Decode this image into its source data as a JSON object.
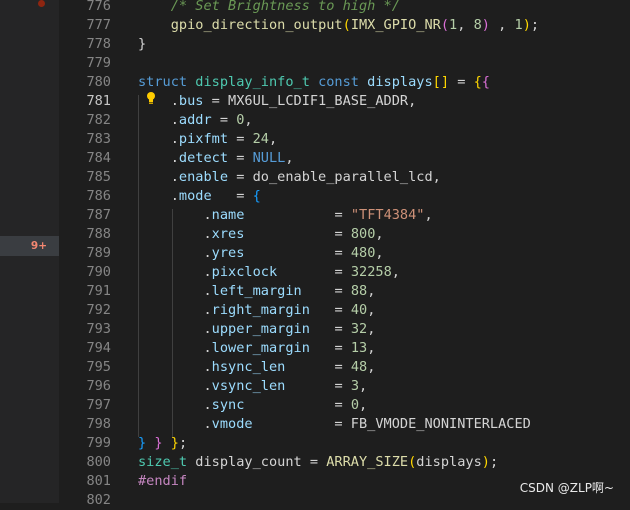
{
  "gutter": {
    "problem_badge": "9+"
  },
  "lines": [
    {
      "n": "776",
      "tokens": [
        [
          "cmt",
          "    /* Set Brightness to high */"
        ]
      ]
    },
    {
      "n": "777",
      "tokens": [
        [
          "txt",
          "    "
        ],
        [
          "fn",
          "gpio_direction_output"
        ],
        [
          "br1",
          "("
        ],
        [
          "fn",
          "IMX_GPIO_NR"
        ],
        [
          "br2",
          "("
        ],
        [
          "num",
          "1"
        ],
        [
          "txt",
          ", "
        ],
        [
          "num",
          "8"
        ],
        [
          "br2",
          ")"
        ],
        [
          "txt",
          " , "
        ],
        [
          "num",
          "1"
        ],
        [
          "br1",
          ")"
        ],
        [
          "txt",
          ";"
        ]
      ]
    },
    {
      "n": "778",
      "tokens": [
        [
          "txt",
          "}"
        ]
      ]
    },
    {
      "n": "779",
      "tokens": []
    },
    {
      "n": "780",
      "tokens": [
        [
          "kw",
          "struct"
        ],
        [
          "txt",
          " "
        ],
        [
          "ty",
          "display_info_t"
        ],
        [
          "txt",
          " "
        ],
        [
          "kw",
          "const"
        ],
        [
          "txt",
          " "
        ],
        [
          "prop",
          "displays"
        ],
        [
          "br1",
          "[]"
        ],
        [
          "txt",
          " = "
        ],
        [
          "br1",
          "{"
        ],
        [
          "br2",
          "{"
        ]
      ]
    },
    {
      "n": "781",
      "active": true,
      "tokens": [
        [
          "txt",
          "    ."
        ],
        [
          "prop",
          "bus"
        ],
        [
          "txt",
          " = MX6UL_LCDIF1_BASE_ADDR,"
        ]
      ]
    },
    {
      "n": "782",
      "tokens": [
        [
          "txt",
          "    ."
        ],
        [
          "prop",
          "addr"
        ],
        [
          "txt",
          " = "
        ],
        [
          "num",
          "0"
        ],
        [
          "txt",
          ","
        ]
      ]
    },
    {
      "n": "783",
      "tokens": [
        [
          "txt",
          "    ."
        ],
        [
          "prop",
          "pixfmt"
        ],
        [
          "txt",
          " = "
        ],
        [
          "num",
          "24"
        ],
        [
          "txt",
          ","
        ]
      ]
    },
    {
      "n": "784",
      "tokens": [
        [
          "txt",
          "    ."
        ],
        [
          "prop",
          "detect"
        ],
        [
          "txt",
          " = "
        ],
        [
          "kw",
          "NULL"
        ],
        [
          "txt",
          ","
        ]
      ]
    },
    {
      "n": "785",
      "tokens": [
        [
          "txt",
          "    ."
        ],
        [
          "prop",
          "enable"
        ],
        [
          "txt",
          " = do_enable_parallel_lcd,"
        ]
      ]
    },
    {
      "n": "786",
      "tokens": [
        [
          "txt",
          "    ."
        ],
        [
          "prop",
          "mode"
        ],
        [
          "txt",
          "   = "
        ],
        [
          "br3",
          "{"
        ]
      ]
    },
    {
      "n": "787",
      "tokens": [
        [
          "txt",
          "        ."
        ],
        [
          "prop",
          "name"
        ],
        [
          "txt",
          "           = "
        ],
        [
          "str",
          "\"TFT4384\""
        ],
        [
          "txt",
          ","
        ]
      ]
    },
    {
      "n": "788",
      "tokens": [
        [
          "txt",
          "        ."
        ],
        [
          "prop",
          "xres"
        ],
        [
          "txt",
          "           = "
        ],
        [
          "num",
          "800"
        ],
        [
          "txt",
          ","
        ]
      ]
    },
    {
      "n": "789",
      "tokens": [
        [
          "txt",
          "        ."
        ],
        [
          "prop",
          "yres"
        ],
        [
          "txt",
          "           = "
        ],
        [
          "num",
          "480"
        ],
        [
          "txt",
          ","
        ]
      ]
    },
    {
      "n": "790",
      "tokens": [
        [
          "txt",
          "        ."
        ],
        [
          "prop",
          "pixclock"
        ],
        [
          "txt",
          "       = "
        ],
        [
          "num",
          "32258"
        ],
        [
          "txt",
          ","
        ]
      ]
    },
    {
      "n": "791",
      "tokens": [
        [
          "txt",
          "        ."
        ],
        [
          "prop",
          "left_margin"
        ],
        [
          "txt",
          "    = "
        ],
        [
          "num",
          "88"
        ],
        [
          "txt",
          ","
        ]
      ]
    },
    {
      "n": "792",
      "tokens": [
        [
          "txt",
          "        ."
        ],
        [
          "prop",
          "right_margin"
        ],
        [
          "txt",
          "   = "
        ],
        [
          "num",
          "40"
        ],
        [
          "txt",
          ","
        ]
      ]
    },
    {
      "n": "793",
      "tokens": [
        [
          "txt",
          "        ."
        ],
        [
          "prop",
          "upper_margin"
        ],
        [
          "txt",
          "   = "
        ],
        [
          "num",
          "32"
        ],
        [
          "txt",
          ","
        ]
      ]
    },
    {
      "n": "794",
      "tokens": [
        [
          "txt",
          "        ."
        ],
        [
          "prop",
          "lower_margin"
        ],
        [
          "txt",
          "   = "
        ],
        [
          "num",
          "13"
        ],
        [
          "txt",
          ","
        ]
      ]
    },
    {
      "n": "795",
      "tokens": [
        [
          "txt",
          "        ."
        ],
        [
          "prop",
          "hsync_len"
        ],
        [
          "txt",
          "      = "
        ],
        [
          "num",
          "48"
        ],
        [
          "txt",
          ","
        ]
      ]
    },
    {
      "n": "796",
      "tokens": [
        [
          "txt",
          "        ."
        ],
        [
          "prop",
          "vsync_len"
        ],
        [
          "txt",
          "      = "
        ],
        [
          "num",
          "3"
        ],
        [
          "txt",
          ","
        ]
      ]
    },
    {
      "n": "797",
      "tokens": [
        [
          "txt",
          "        ."
        ],
        [
          "prop",
          "sync"
        ],
        [
          "txt",
          "           = "
        ],
        [
          "num",
          "0"
        ],
        [
          "txt",
          ","
        ]
      ]
    },
    {
      "n": "798",
      "tokens": [
        [
          "txt",
          "        ."
        ],
        [
          "prop",
          "vmode"
        ],
        [
          "txt",
          "          = FB_VMODE_NONINTERLACED"
        ]
      ]
    },
    {
      "n": "799",
      "tokens": [
        [
          "br3",
          "}"
        ],
        [
          "txt",
          " "
        ],
        [
          "br2",
          "}"
        ],
        [
          "txt",
          " "
        ],
        [
          "br1",
          "}"
        ],
        [
          "txt",
          ";"
        ]
      ]
    },
    {
      "n": "800",
      "tokens": [
        [
          "ty",
          "size_t"
        ],
        [
          "txt",
          " display_count = "
        ],
        [
          "fn",
          "ARRAY_SIZE"
        ],
        [
          "br1",
          "("
        ],
        [
          "txt",
          "displays"
        ],
        [
          "br1",
          ")"
        ],
        [
          "txt",
          ";"
        ]
      ]
    },
    {
      "n": "801",
      "tokens": [
        [
          "pre",
          "#endif"
        ]
      ]
    },
    {
      "n": "802",
      "tokens": []
    }
  ],
  "watermark": "CSDN @ZLP啊~",
  "colors": {
    "background": "#1e1e1e",
    "keyword": "#569cd6",
    "type": "#4ec9b0",
    "function": "#dcdcaa",
    "number": "#b5cea8",
    "string": "#ce9178",
    "property": "#9cdcfe",
    "comment": "#6a9955",
    "problem": "#f48771"
  },
  "icons": {
    "code_action": "lightbulb-icon",
    "breakpoint": "breakpoint-dot-icon"
  }
}
